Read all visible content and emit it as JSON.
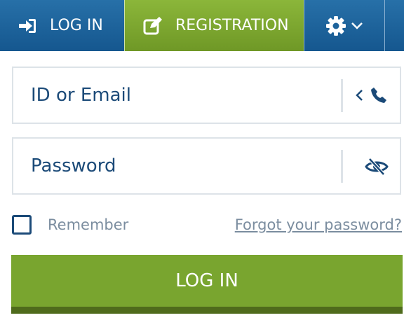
{
  "header": {
    "login_tab": {
      "label": "LOG IN",
      "icon": "sign-in-icon"
    },
    "registration_tab": {
      "label": "REGISTRATION",
      "icon": "edit-icon"
    },
    "settings_tab": {
      "icon": "gear-icon",
      "dropdown_icon": "chevron-down-icon"
    }
  },
  "form": {
    "id_field": {
      "placeholder": "ID or Email",
      "value": "",
      "addon_icons": [
        "chevron-left-icon",
        "phone-icon"
      ]
    },
    "password_field": {
      "placeholder": "Password",
      "value": "",
      "addon_icon": "eye-slash-icon"
    },
    "remember": {
      "label": "Remember",
      "checked": false
    },
    "forgot_link": "Forgot your password?",
    "submit_label": "LOG IN"
  },
  "colors": {
    "primary_blue": "#1b5e97",
    "accent_green": "#79a52f",
    "dark_green": "#4f6b1c",
    "text_blue": "#1b4a78",
    "muted_text": "#7b8d9f",
    "border": "#dde3e8"
  }
}
